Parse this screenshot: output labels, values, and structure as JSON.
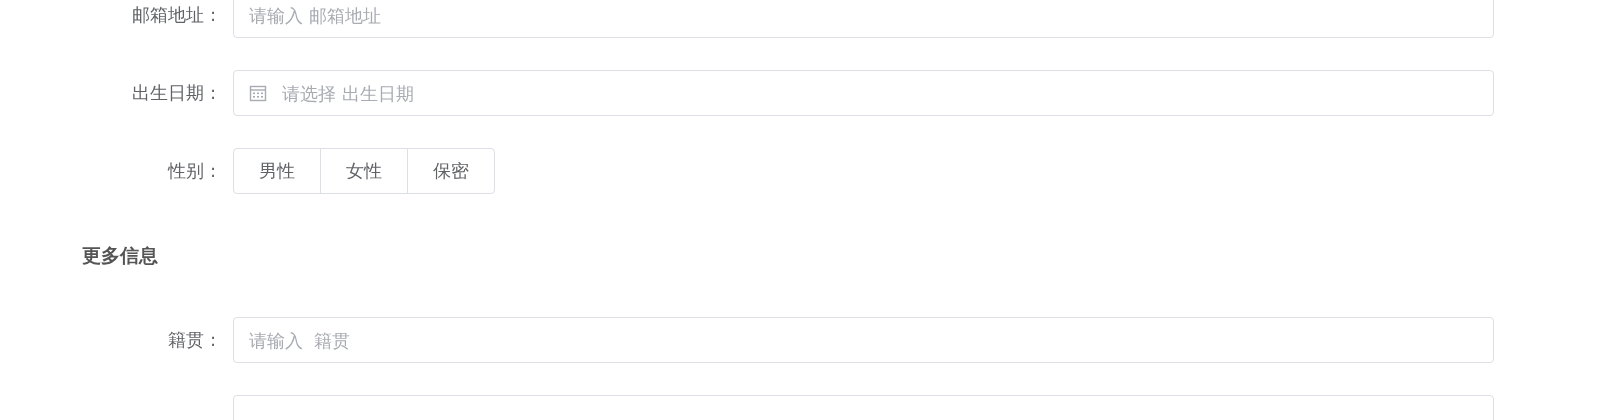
{
  "sections": [
    {
      "fields": [
        {
          "kind": "input",
          "label": "邮箱地址 :",
          "placeholder": "请输入 邮箱地址"
        },
        {
          "kind": "date",
          "label": "出生日期 :",
          "placeholder": "请选择 出生日期"
        },
        {
          "kind": "radio",
          "label": "性别 :",
          "options": [
            {
              "label": "男性",
              "selected": false
            },
            {
              "label": "女性",
              "selected": false
            },
            {
              "label": "保密",
              "selected": false
            }
          ]
        }
      ]
    },
    {
      "title": "更多信息",
      "fields": [
        {
          "kind": "input",
          "label": "籍贯 :",
          "placeholder": "请输入  籍贯"
        },
        {
          "kind": "input"
        }
      ]
    }
  ]
}
